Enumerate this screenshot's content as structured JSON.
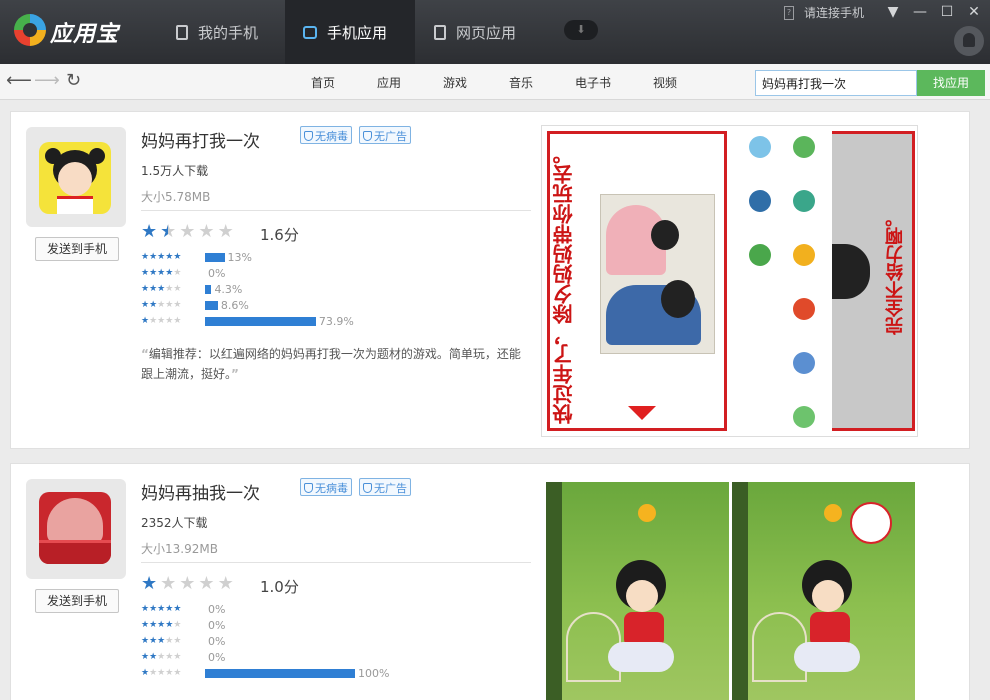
{
  "app": {
    "name": "应用宝"
  },
  "tabs": [
    {
      "label": "我的手机"
    },
    {
      "label": "手机应用"
    },
    {
      "label": "网页应用"
    }
  ],
  "window": {
    "connect_label": "请连接手机"
  },
  "nav": {
    "items": [
      "首页",
      "应用",
      "游戏",
      "音乐",
      "电子书",
      "视频"
    ],
    "search_value": "妈妈再打我一次",
    "search_button": "找应用"
  },
  "apps": [
    {
      "title": "妈妈再打我一次",
      "badges": [
        "无病毒",
        "无广告"
      ],
      "downloads": "1.5万人下载",
      "size": "大小5.78MB",
      "score": "1.6分",
      "rating_stars": 1.5,
      "send_button": "发送到手机",
      "distribution": [
        {
          "stars": 5,
          "percent": 13,
          "label": "13%"
        },
        {
          "stars": 4,
          "percent": 0,
          "label": "0%"
        },
        {
          "stars": 3,
          "percent": 4.3,
          "label": "4.3%"
        },
        {
          "stars": 2,
          "percent": 8.6,
          "label": "8.6%"
        },
        {
          "stars": 1,
          "percent": 73.9,
          "label": "73.9%"
        }
      ],
      "review": "编辑推荐：以红遍网络的妈妈再打我一次为题材的游戏。简单玩，还能跟上潮流，挺好。",
      "screenshot_text_1": "快过年了，除夕妈妈带你玩去。",
      "screenshot_text_2": "完全不给力啊。"
    },
    {
      "title": "妈妈再抽我一次",
      "badges": [
        "无病毒",
        "无广告"
      ],
      "downloads": "2352人下载",
      "size": "大小13.92MB",
      "score": "1.0分",
      "rating_stars": 1,
      "send_button": "发送到手机",
      "distribution": [
        {
          "stars": 5,
          "percent": 0,
          "label": "0%"
        },
        {
          "stars": 4,
          "percent": 0,
          "label": "0%"
        },
        {
          "stars": 3,
          "percent": 0,
          "label": "0%"
        },
        {
          "stars": 2,
          "percent": 0,
          "label": "0%"
        },
        {
          "stars": 1,
          "percent": 100,
          "label": "100%"
        }
      ]
    }
  ],
  "colors": {
    "titlebar": "#2c2e32",
    "accent_blue": "#2f7fd4",
    "search_button": "#5cb85c",
    "badge_blue": "#4a90d9",
    "screenshot_red": "#d21e22"
  },
  "icons": {
    "logo": "app-logo-icon",
    "phone": "phone-icon",
    "apps": "app-store-icon",
    "web": "web-page-icon",
    "download": "download-icon",
    "connect": "phone-connect-icon",
    "back": "back-arrow-icon",
    "forward": "forward-arrow-icon",
    "refresh": "refresh-icon"
  }
}
